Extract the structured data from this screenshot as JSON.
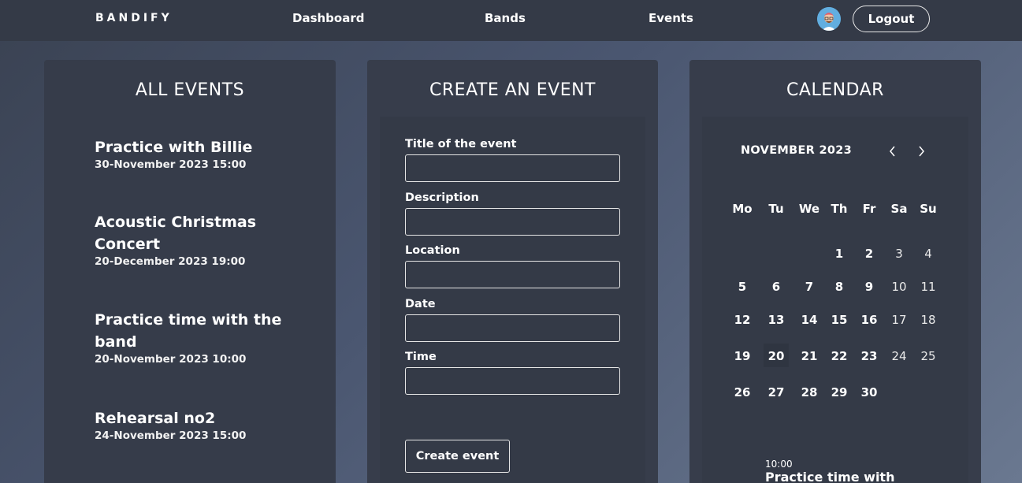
{
  "nav": {
    "brand": "BANDIFY",
    "links": [
      "Dashboard",
      "Bands",
      "Events"
    ],
    "logout_label": "Logout"
  },
  "all_events": {
    "title": "ALL EVENTS",
    "items": [
      {
        "title": "Practice with Billie",
        "date": "30-November 2023 15:00"
      },
      {
        "title": "Acoustic Christmas Concert",
        "date": "20-December 2023 19:00"
      },
      {
        "title": "Practice time with the band",
        "date": "20-November 2023 10:00"
      },
      {
        "title": "Rehearsal no2",
        "date": "24-November 2023 15:00"
      }
    ]
  },
  "create_event": {
    "title": "CREATE AN EVENT",
    "fields": [
      {
        "label": "Title of the event",
        "value": ""
      },
      {
        "label": "Description",
        "value": ""
      },
      {
        "label": "Location",
        "value": ""
      },
      {
        "label": "Date",
        "value": ""
      },
      {
        "label": "Time",
        "value": ""
      }
    ],
    "submit_label": "Create event"
  },
  "calendar": {
    "title": "CALENDAR",
    "month_label": "NOVEMBER 2023",
    "prev_icon": "chevron-left-icon",
    "next_icon": "chevron-right-icon",
    "weekdays": [
      "Mo",
      "Tu",
      "We",
      "Th",
      "Fr",
      "Sa",
      "Su"
    ],
    "weeks": [
      [
        "",
        "",
        "",
        "1",
        "2",
        "3",
        "4"
      ],
      [
        "5",
        "6",
        "7",
        "8",
        "9",
        "10",
        "11"
      ],
      [
        "12",
        "13",
        "14",
        "15",
        "16",
        "17",
        "18"
      ],
      [
        "19",
        "20",
        "21",
        "22",
        "23",
        "24",
        "25"
      ],
      [
        "26",
        "27",
        "28",
        "29",
        "30",
        "",
        ""
      ]
    ],
    "selected_day": "20",
    "event_time": "10:00",
    "event_title": "Practice time with"
  }
}
